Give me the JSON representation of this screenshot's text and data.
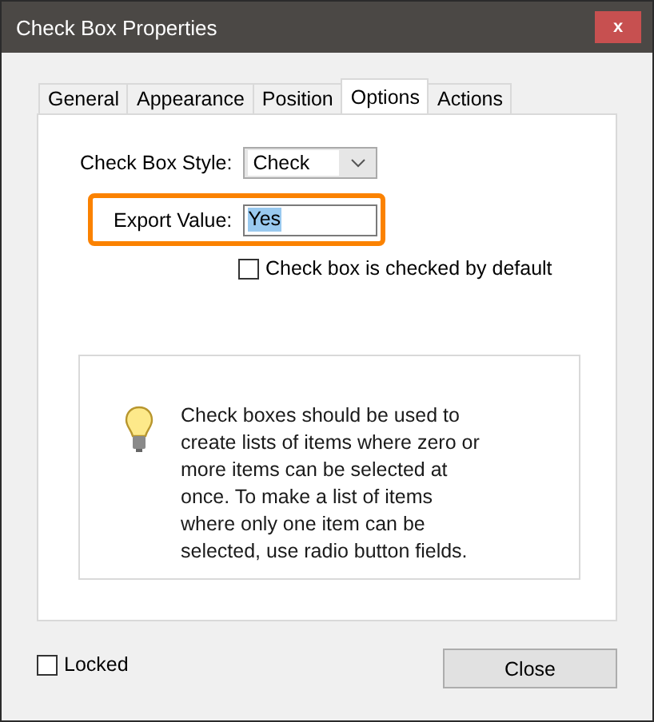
{
  "window": {
    "title": "Check Box Properties",
    "close": "x"
  },
  "tabs": [
    {
      "label": "General",
      "selected": false
    },
    {
      "label": "Appearance",
      "selected": false
    },
    {
      "label": "Position",
      "selected": false
    },
    {
      "label": "Options",
      "selected": true
    },
    {
      "label": "Actions",
      "selected": false
    }
  ],
  "style": {
    "label": "Check Box Style:",
    "value": "Check"
  },
  "export": {
    "label": "Export Value:",
    "value": "Yes",
    "highlighted": true
  },
  "default_checkbox": {
    "label": "Check box is checked by default",
    "checked": false
  },
  "info": "Check boxes should be used to create lists of items where zero or more items can be selected at once. To make a list of items where only one item can be selected, use radio button fields.",
  "locked": {
    "label": "Locked",
    "checked": false
  },
  "buttons": [
    "Close"
  ]
}
